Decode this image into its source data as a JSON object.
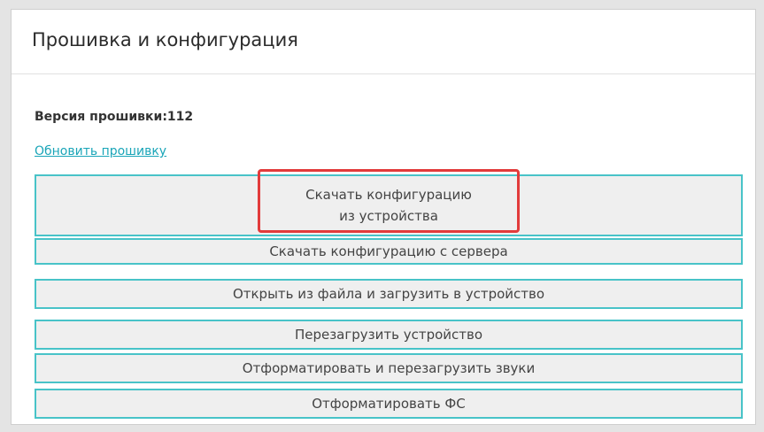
{
  "panel": {
    "title": "Прошивка и конфигурация"
  },
  "firmware": {
    "label": "Версия прошивки:",
    "version": "112"
  },
  "update_link": "Обновить прошивку",
  "buttons": {
    "download_from_device": {
      "line1": "Скачать конфигурацию",
      "line2": "из устройства"
    },
    "download_from_server": "Скачать конфигурацию с сервера",
    "open_file_upload": "Открыть из файла и загрузить в устройство",
    "reboot_device": "Перезагрузить устройство",
    "format_reload_sounds": "Отформатировать и перезагрузить звуки",
    "format_fs": "Отформатировать ФС"
  },
  "colors": {
    "button_border": "#48c3c8",
    "button_bg": "#efefef",
    "link": "#1aa5b8",
    "highlight": "#e23b3b"
  }
}
